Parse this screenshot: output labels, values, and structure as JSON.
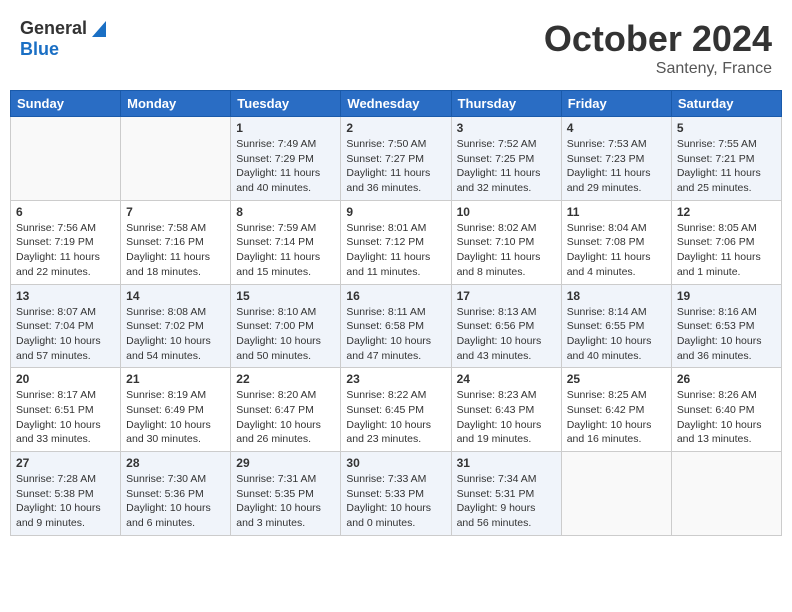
{
  "header": {
    "logo_general": "General",
    "logo_blue": "Blue",
    "month": "October 2024",
    "location": "Santeny, France"
  },
  "weekdays": [
    "Sunday",
    "Monday",
    "Tuesday",
    "Wednesday",
    "Thursday",
    "Friday",
    "Saturday"
  ],
  "weeks": [
    [
      {
        "day": "",
        "sunrise": "",
        "sunset": "",
        "daylight": ""
      },
      {
        "day": "",
        "sunrise": "",
        "sunset": "",
        "daylight": ""
      },
      {
        "day": "1",
        "sunrise": "Sunrise: 7:49 AM",
        "sunset": "Sunset: 7:29 PM",
        "daylight": "Daylight: 11 hours and 40 minutes."
      },
      {
        "day": "2",
        "sunrise": "Sunrise: 7:50 AM",
        "sunset": "Sunset: 7:27 PM",
        "daylight": "Daylight: 11 hours and 36 minutes."
      },
      {
        "day": "3",
        "sunrise": "Sunrise: 7:52 AM",
        "sunset": "Sunset: 7:25 PM",
        "daylight": "Daylight: 11 hours and 32 minutes."
      },
      {
        "day": "4",
        "sunrise": "Sunrise: 7:53 AM",
        "sunset": "Sunset: 7:23 PM",
        "daylight": "Daylight: 11 hours and 29 minutes."
      },
      {
        "day": "5",
        "sunrise": "Sunrise: 7:55 AM",
        "sunset": "Sunset: 7:21 PM",
        "daylight": "Daylight: 11 hours and 25 minutes."
      }
    ],
    [
      {
        "day": "6",
        "sunrise": "Sunrise: 7:56 AM",
        "sunset": "Sunset: 7:19 PM",
        "daylight": "Daylight: 11 hours and 22 minutes."
      },
      {
        "day": "7",
        "sunrise": "Sunrise: 7:58 AM",
        "sunset": "Sunset: 7:16 PM",
        "daylight": "Daylight: 11 hours and 18 minutes."
      },
      {
        "day": "8",
        "sunrise": "Sunrise: 7:59 AM",
        "sunset": "Sunset: 7:14 PM",
        "daylight": "Daylight: 11 hours and 15 minutes."
      },
      {
        "day": "9",
        "sunrise": "Sunrise: 8:01 AM",
        "sunset": "Sunset: 7:12 PM",
        "daylight": "Daylight: 11 hours and 11 minutes."
      },
      {
        "day": "10",
        "sunrise": "Sunrise: 8:02 AM",
        "sunset": "Sunset: 7:10 PM",
        "daylight": "Daylight: 11 hours and 8 minutes."
      },
      {
        "day": "11",
        "sunrise": "Sunrise: 8:04 AM",
        "sunset": "Sunset: 7:08 PM",
        "daylight": "Daylight: 11 hours and 4 minutes."
      },
      {
        "day": "12",
        "sunrise": "Sunrise: 8:05 AM",
        "sunset": "Sunset: 7:06 PM",
        "daylight": "Daylight: 11 hours and 1 minute."
      }
    ],
    [
      {
        "day": "13",
        "sunrise": "Sunrise: 8:07 AM",
        "sunset": "Sunset: 7:04 PM",
        "daylight": "Daylight: 10 hours and 57 minutes."
      },
      {
        "day": "14",
        "sunrise": "Sunrise: 8:08 AM",
        "sunset": "Sunset: 7:02 PM",
        "daylight": "Daylight: 10 hours and 54 minutes."
      },
      {
        "day": "15",
        "sunrise": "Sunrise: 8:10 AM",
        "sunset": "Sunset: 7:00 PM",
        "daylight": "Daylight: 10 hours and 50 minutes."
      },
      {
        "day": "16",
        "sunrise": "Sunrise: 8:11 AM",
        "sunset": "Sunset: 6:58 PM",
        "daylight": "Daylight: 10 hours and 47 minutes."
      },
      {
        "day": "17",
        "sunrise": "Sunrise: 8:13 AM",
        "sunset": "Sunset: 6:56 PM",
        "daylight": "Daylight: 10 hours and 43 minutes."
      },
      {
        "day": "18",
        "sunrise": "Sunrise: 8:14 AM",
        "sunset": "Sunset: 6:55 PM",
        "daylight": "Daylight: 10 hours and 40 minutes."
      },
      {
        "day": "19",
        "sunrise": "Sunrise: 8:16 AM",
        "sunset": "Sunset: 6:53 PM",
        "daylight": "Daylight: 10 hours and 36 minutes."
      }
    ],
    [
      {
        "day": "20",
        "sunrise": "Sunrise: 8:17 AM",
        "sunset": "Sunset: 6:51 PM",
        "daylight": "Daylight: 10 hours and 33 minutes."
      },
      {
        "day": "21",
        "sunrise": "Sunrise: 8:19 AM",
        "sunset": "Sunset: 6:49 PM",
        "daylight": "Daylight: 10 hours and 30 minutes."
      },
      {
        "day": "22",
        "sunrise": "Sunrise: 8:20 AM",
        "sunset": "Sunset: 6:47 PM",
        "daylight": "Daylight: 10 hours and 26 minutes."
      },
      {
        "day": "23",
        "sunrise": "Sunrise: 8:22 AM",
        "sunset": "Sunset: 6:45 PM",
        "daylight": "Daylight: 10 hours and 23 minutes."
      },
      {
        "day": "24",
        "sunrise": "Sunrise: 8:23 AM",
        "sunset": "Sunset: 6:43 PM",
        "daylight": "Daylight: 10 hours and 19 minutes."
      },
      {
        "day": "25",
        "sunrise": "Sunrise: 8:25 AM",
        "sunset": "Sunset: 6:42 PM",
        "daylight": "Daylight: 10 hours and 16 minutes."
      },
      {
        "day": "26",
        "sunrise": "Sunrise: 8:26 AM",
        "sunset": "Sunset: 6:40 PM",
        "daylight": "Daylight: 10 hours and 13 minutes."
      }
    ],
    [
      {
        "day": "27",
        "sunrise": "Sunrise: 7:28 AM",
        "sunset": "Sunset: 5:38 PM",
        "daylight": "Daylight: 10 hours and 9 minutes."
      },
      {
        "day": "28",
        "sunrise": "Sunrise: 7:30 AM",
        "sunset": "Sunset: 5:36 PM",
        "daylight": "Daylight: 10 hours and 6 minutes."
      },
      {
        "day": "29",
        "sunrise": "Sunrise: 7:31 AM",
        "sunset": "Sunset: 5:35 PM",
        "daylight": "Daylight: 10 hours and 3 minutes."
      },
      {
        "day": "30",
        "sunrise": "Sunrise: 7:33 AM",
        "sunset": "Sunset: 5:33 PM",
        "daylight": "Daylight: 10 hours and 0 minutes."
      },
      {
        "day": "31",
        "sunrise": "Sunrise: 7:34 AM",
        "sunset": "Sunset: 5:31 PM",
        "daylight": "Daylight: 9 hours and 56 minutes."
      },
      {
        "day": "",
        "sunrise": "",
        "sunset": "",
        "daylight": ""
      },
      {
        "day": "",
        "sunrise": "",
        "sunset": "",
        "daylight": ""
      }
    ]
  ]
}
